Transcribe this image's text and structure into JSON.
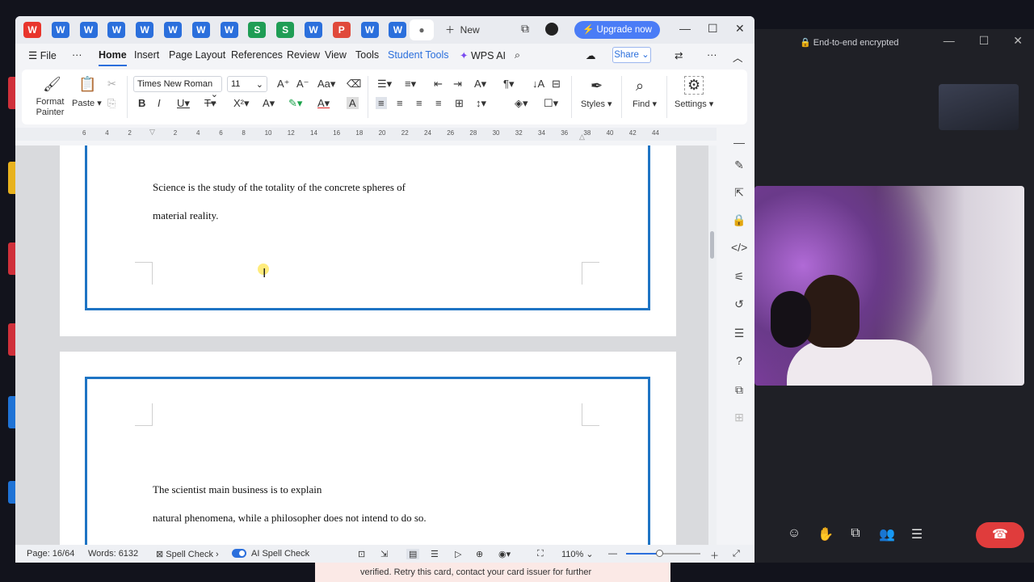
{
  "colors": {
    "accent": "#2b6fdc",
    "frame": "#1e74c4",
    "upgrade": "#4a7cf6",
    "hangup": "#e03c3c"
  },
  "window": {
    "tabs": [
      {
        "type": "wps-logo"
      },
      {
        "type": "word",
        "glyph": "W"
      },
      {
        "type": "word",
        "glyph": "W"
      },
      {
        "type": "word",
        "glyph": "W"
      },
      {
        "type": "word",
        "glyph": "W"
      },
      {
        "type": "word",
        "glyph": "W"
      },
      {
        "type": "word",
        "glyph": "W"
      },
      {
        "type": "word",
        "glyph": "W"
      },
      {
        "type": "sheet",
        "glyph": "S"
      },
      {
        "type": "sheet",
        "glyph": "S"
      },
      {
        "type": "word",
        "glyph": "W"
      },
      {
        "type": "pdf",
        "glyph": "P"
      },
      {
        "type": "word",
        "glyph": "W"
      },
      {
        "type": "word",
        "glyph": "W"
      }
    ],
    "new_tab_label": "New",
    "upgrade_label": "Upgrade now"
  },
  "menu": {
    "file": "File",
    "items": [
      "Home",
      "Insert",
      "Page Layout",
      "References",
      "Review",
      "View",
      "Tools",
      "Student Tools"
    ],
    "wps_ai": "WPS AI",
    "share": "Share"
  },
  "ribbon": {
    "format_painter": "Format Painter",
    "paste": "Paste",
    "font_name": "Times New Roman",
    "font_size": "11",
    "styles": "Styles",
    "find": "Find",
    "settings": "Settings"
  },
  "ruler": {
    "ticks": [
      "6",
      "4",
      "2",
      "",
      "2",
      "4",
      "6",
      "8",
      "10",
      "12",
      "14",
      "16",
      "18",
      "20",
      "22",
      "24",
      "26",
      "28",
      "30",
      "32",
      "34",
      "36",
      "38",
      "40",
      "42",
      "44"
    ]
  },
  "document": {
    "page1_lines": [
      "Science is the study of the totality of the concrete spheres of",
      "material reality."
    ],
    "page2_lines": [
      "The scientist main business is to explain",
      "natural phenomena, while a philosopher does not intend to do so."
    ]
  },
  "status": {
    "page": "Page: 16/64",
    "words": "Words: 6132",
    "spell_check": "Spell Check",
    "ai_spell_check": "AI Spell Check",
    "zoom": "110%",
    "zoom_level": 0.45
  },
  "call": {
    "encrypted": "End-to-end encrypted"
  },
  "notification": {
    "text": "verified. Retry this card, contact your card issuer for further"
  }
}
